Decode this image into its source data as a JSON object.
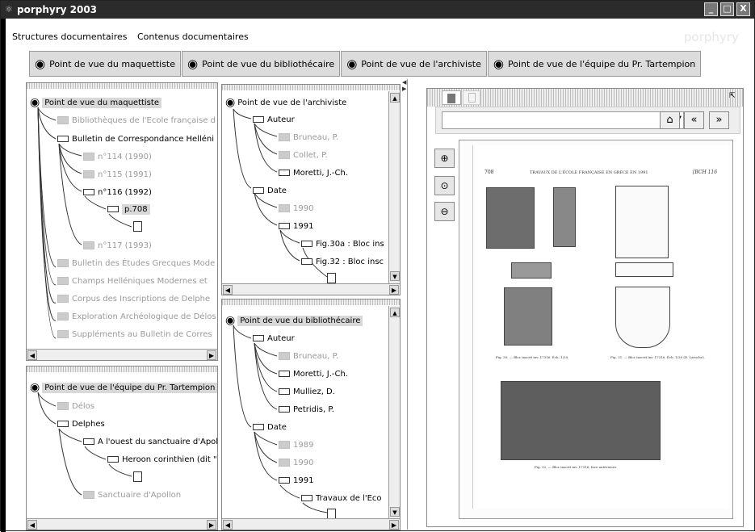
{
  "window": {
    "title": "porphyry 2003",
    "minimize": "_",
    "maximize": "□",
    "close": "X"
  },
  "menu": [
    "Structures documentaires",
    "Contenus documentaires"
  ],
  "brand": "porphyry",
  "toolbar": [
    "Point de vue du maquettiste",
    "Point de vue du bibliothécaire",
    "Point de vue de l'archiviste",
    "Point de vue de l'équipe du Pr. Tartempion"
  ],
  "panel_maquettiste": {
    "root": "Point de vue du maquettiste",
    "nodes": [
      "Bibliothèques de l'Ecole française d",
      "Bulletin de Correspondance Helléni",
      "n°114 (1990)",
      "n°115 (1991)",
      "n°116 (1992)",
      "p.708",
      "n°117 (1993)",
      "Bulletin des Études Grecques Mode",
      "Champs Helléniques Modernes et",
      "Corpus des Inscriptions de Delphe",
      "Exploration Archéologique de Délos",
      "Suppléments au Bulletin de Corres"
    ]
  },
  "panel_tartempion": {
    "root": "Point de vue de l'équipe du Pr. Tartempion",
    "nodes": [
      "Délos",
      "Delphes",
      "A l'ouest du sanctuaire d'Apol",
      "Heroon corinthien (dit \"",
      "Sanctuaire d'Apollon"
    ]
  },
  "panel_archiviste": {
    "root": "Point de vue de l'archiviste",
    "nodes": [
      "Auteur",
      "Bruneau, P.",
      "Collet, P.",
      "Moretti, J.-Ch.",
      "Date",
      "1990",
      "1991",
      "Fig.30a : Bloc ins",
      "Fig.32 : Bloc insc"
    ]
  },
  "panel_bibliothecaire": {
    "root": "Point de vue du bibliothécaire",
    "nodes": [
      "Auteur",
      "Bruneau, P.",
      "Moretti, J.-Ch.",
      "Mulliez, D.",
      "Petridis, P.",
      "Date",
      "1989",
      "1990",
      "1991",
      "Travaux de l'Eco"
    ]
  },
  "viewer": {
    "nav_icons": {
      "home": "⌂",
      "prev": "«",
      "next": "»"
    },
    "zoom_icons": [
      "zoom-in",
      "zoom-reset",
      "zoom-out"
    ],
    "document": {
      "page_number": "708",
      "running_head": "TRAVAUX DE L'ÉCOLE FRANÇAISE EN GRÈCE EN 1991",
      "journal": "[BCH 116",
      "caption_30": "Fig. 30. — Bloc inscrit inv. 17316. Éch. 1/30.",
      "caption_31": "Fig. 31. — Bloc inscrit inv. 17316. Éch. 1/30 (D. Laroche).",
      "caption_32": "Fig. 32. — Bloc inscrit inv. 17316, face antérieure."
    }
  }
}
